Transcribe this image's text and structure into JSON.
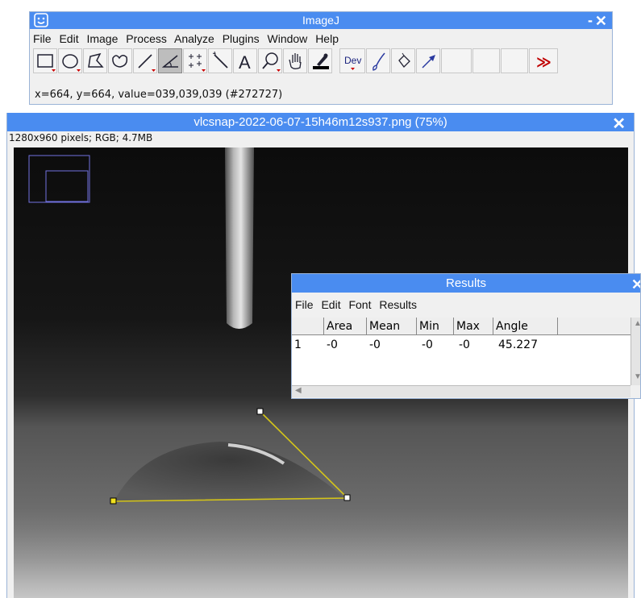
{
  "main_window": {
    "title": "ImageJ",
    "minimize_glyph": "-",
    "close_glyph": "✕",
    "menus": [
      "File",
      "Edit",
      "Image",
      "Process",
      "Analyze",
      "Plugins",
      "Window",
      "Help"
    ],
    "tools": [
      {
        "icon": "rectangle-tool-icon"
      },
      {
        "icon": "oval-tool-icon"
      },
      {
        "icon": "polygon-tool-icon"
      },
      {
        "icon": "freehand-tool-icon"
      },
      {
        "icon": "line-tool-icon"
      },
      {
        "icon": "angle-tool-icon",
        "selected": true
      },
      {
        "icon": "multipoint-tool-icon"
      },
      {
        "icon": "wand-tool-icon"
      },
      {
        "icon": "text-tool-icon",
        "label": "A"
      },
      {
        "icon": "magnifier-tool-icon"
      },
      {
        "icon": "hand-tool-icon"
      },
      {
        "icon": "color-picker-tool-icon"
      },
      {
        "icon": "developer-menu-icon",
        "label": "Dev"
      },
      {
        "icon": "brush-tool-icon"
      },
      {
        "icon": "flood-fill-tool-icon"
      },
      {
        "icon": "arrow-tool-icon"
      },
      {
        "icon": "empty-slot-icon"
      },
      {
        "icon": "empty-slot-icon"
      },
      {
        "icon": "empty-slot-icon"
      },
      {
        "icon": "more-tools-icon",
        "label": "≫"
      }
    ],
    "status": "x=664, y=664, value=039,039,039 (#272727)",
    "title_bar_color": "#4a8cf0"
  },
  "image_window": {
    "title": "vlcsnap-2022-06-07-15h46m12s937.png (75%)",
    "close_glyph": "✕",
    "info": "1280x960 pixels; RGB; 4.7MB",
    "selection_color": "#d4c41a",
    "navigator_color": "#7272e0"
  },
  "results_window": {
    "title": "Results",
    "close_glyph": "✕",
    "menus": [
      "File",
      "Edit",
      "Font",
      "Results"
    ],
    "columns": [
      "",
      "Area",
      "Mean",
      "Min",
      "Max",
      "Angle"
    ],
    "rows": [
      [
        "1",
        "-0",
        "-0",
        "-0",
        "-0",
        "45.227"
      ]
    ]
  }
}
